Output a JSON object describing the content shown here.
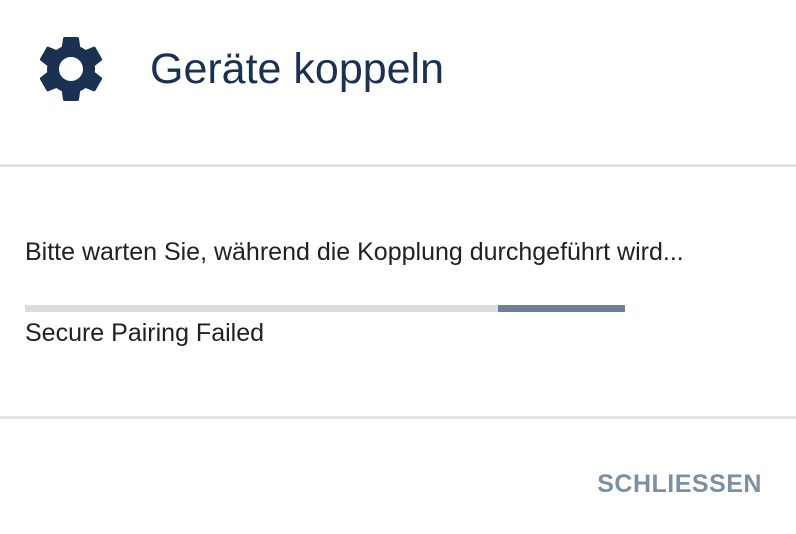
{
  "dialog": {
    "icon": "gear-icon",
    "title": "Geräte koppeln",
    "message": "Bitte warten Sie, während die Kopplung durchgeführt wird...",
    "status": "Secure Pairing Failed",
    "close_label": "SCHLIESSEN",
    "progress_indeterminate": true
  },
  "colors": {
    "title": "#1b3152",
    "icon": "#1b3152",
    "progress_track": "#dcdcdc",
    "progress_fill": "#6b7f96",
    "button_text": "#7d8fa3",
    "divider": "#e3e3e3"
  }
}
